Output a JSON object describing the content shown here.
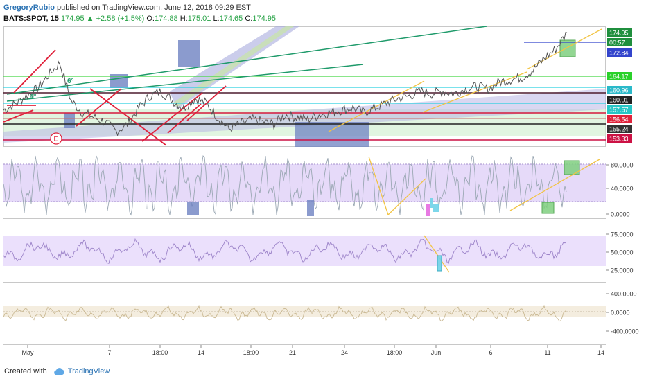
{
  "header": {
    "author": "GregoryRubio",
    "published": "published on TradingView.com, June 12, 2018 09:29 EST",
    "symbol": "BATS:SPOT, 15",
    "last": "174.95",
    "change": "▲ +2.58 (+1.5%)",
    "o_label": "O:",
    "o_value": "174.88",
    "h_label": "H:",
    "h_value": "175.01",
    "l_label": "L:",
    "l_value": "174.65",
    "c_label": "C:",
    "c_value": "174.95"
  },
  "footer": {
    "created_with": "Created with",
    "brand": "TradingView"
  },
  "colors": {
    "up": "#26a245",
    "down": "#e0223b",
    "link": "#2a72b3",
    "price_line": "#555555",
    "stoch_band": "#d6c2f5",
    "osc_line": "#9aa7b3"
  },
  "chart_data": {
    "type": "line",
    "x_ticks": [
      "May",
      "7",
      "18:00",
      "14",
      "18:00",
      "21",
      "24",
      "18:00",
      "Jun",
      "6",
      "11",
      "14"
    ],
    "price_axis": {
      "labels": [
        "174.95",
        "00:57",
        "172.84",
        "164.17",
        "160.96",
        "160.01",
        "157.57",
        "156.54",
        "155.24",
        "153.33"
      ],
      "colors": [
        "#1f8f3d",
        "#1f8f3d",
        "#3344cc",
        "#2ad12a",
        "#2ab9c9",
        "#222222",
        "#27c6c6",
        "#e0223b",
        "#333333",
        "#cc1144"
      ]
    },
    "panes": [
      {
        "name": "price",
        "ylim": [
          151,
          176
        ],
        "last": 174.95
      },
      {
        "name": "stoch",
        "ticks": [
          "80.0000",
          "40.0000",
          "0.0000"
        ],
        "ylim": [
          -5,
          95
        ],
        "band": [
          20,
          80
        ]
      },
      {
        "name": "rsi",
        "ticks": [
          "75.0000",
          "50.0000",
          "25.0000"
        ],
        "ylim": [
          0,
          100
        ],
        "band": [
          30,
          70
        ]
      },
      {
        "name": "osc",
        "ticks": [
          "400.0000",
          "0.0000",
          "-400.0000"
        ],
        "ylim": [
          -550,
          550
        ]
      }
    ],
    "price_series": {
      "x": [
        0,
        2,
        4,
        6,
        8,
        10,
        12,
        14,
        16,
        18,
        20,
        22,
        24,
        26,
        28,
        30,
        32,
        34,
        36,
        38,
        40,
        42,
        44,
        46,
        48,
        50,
        52,
        54,
        56,
        58,
        60,
        62,
        64,
        66,
        68,
        70,
        72,
        74,
        76,
        78,
        80,
        82,
        84,
        86,
        88,
        90,
        92,
        94,
        96,
        98,
        100
      ],
      "values": [
        158.5,
        159.8,
        161.5,
        163.0,
        166.0,
        168.5,
        160.5,
        158.0,
        157.0,
        156.0,
        154.0,
        155.5,
        159.0,
        161.5,
        162.5,
        160.5,
        159.0,
        161.0,
        160.0,
        157.0,
        154.5,
        155.5,
        156.5,
        156.0,
        155.5,
        157.5,
        157.0,
        156.5,
        157.5,
        158.0,
        158.5,
        159.0,
        158.0,
        159.0,
        160.0,
        161.0,
        161.5,
        162.5,
        162.0,
        162.5,
        162.0,
        163.0,
        163.5,
        163.0,
        164.5,
        165.0,
        165.5,
        167.0,
        169.5,
        171.5,
        174.95
      ]
    }
  }
}
